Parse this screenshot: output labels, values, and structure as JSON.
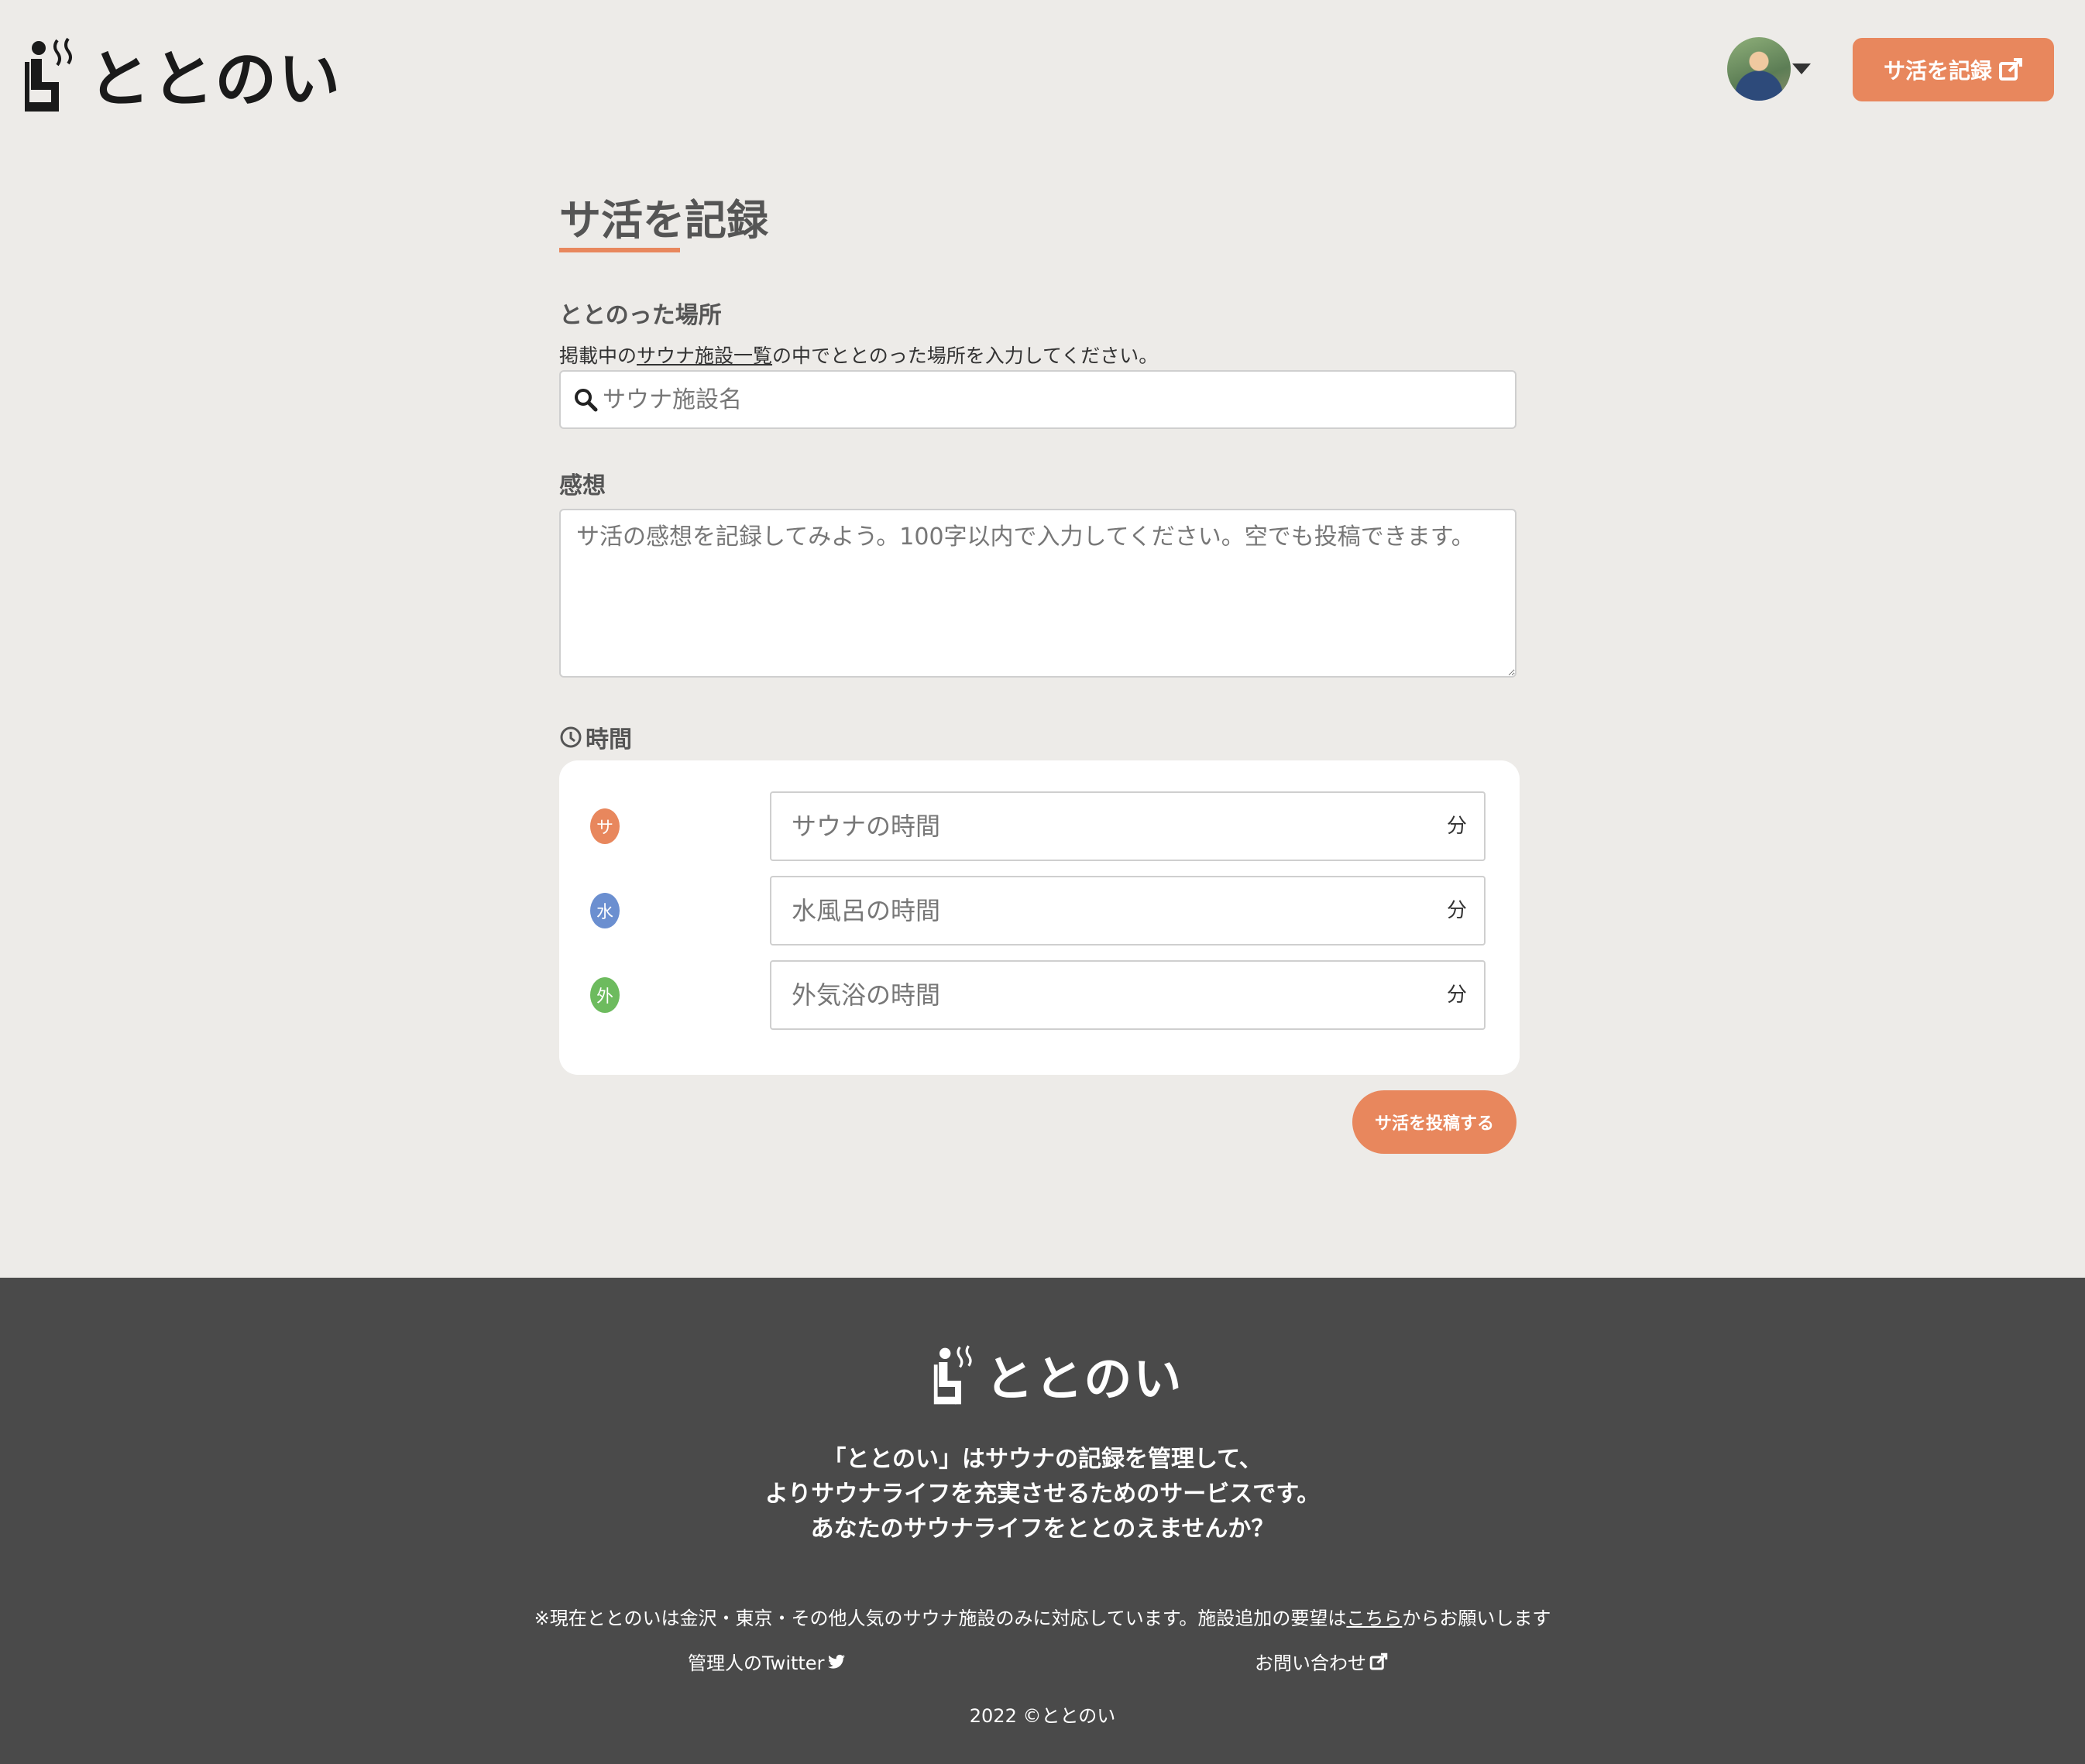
{
  "header": {
    "logo_text": "ととのい",
    "record_button_label": "サ活を記録"
  },
  "form": {
    "title": "サ活を記録",
    "place_label": "ととのった場所",
    "place_help_prefix": "掲載中の",
    "place_help_link": "サウナ施設一覧",
    "place_help_suffix": "の中でととのった場所を入力してください。",
    "place_placeholder": "サウナ施設名",
    "impression_label": "感想",
    "impression_placeholder": "サ活の感想を記録してみよう。100字以内で入力してください。空でも投稿できます。",
    "time_label": "時間",
    "times": [
      {
        "badge": "サ",
        "placeholder": "サウナの時間",
        "unit": "分",
        "color": "#e8875d"
      },
      {
        "badge": "水",
        "placeholder": "水風呂の時間",
        "unit": "分",
        "color": "#6b8fd0"
      },
      {
        "badge": "外",
        "placeholder": "外気浴の時間",
        "unit": "分",
        "color": "#6dbb5e"
      }
    ],
    "submit_label": "サ活を投稿する"
  },
  "footer": {
    "logo_text": "ととのい",
    "desc_line1": "「ととのい」はサウナの記録を管理して、",
    "desc_line2": "よりサウナライフを充実させるためのサービスです。",
    "desc_line3": "あなたのサウナライフをととのえませんか？",
    "note_prefix": "※現在ととのいは金沢・東京・その他人気のサウナ施設のみに対応しています。施設追加の要望は",
    "note_link": "こちら",
    "note_suffix": "からお願いします",
    "twitter_label": "管理人のTwitter",
    "contact_label": "お問い合わせ",
    "copyright": "2022 ©ととのい"
  },
  "colors": {
    "accent": "#e8875d",
    "background": "#edebe8",
    "footer": "#4a4a4a"
  },
  "icons": [
    "sauna-logo-icon",
    "external-link-icon",
    "search-icon",
    "clock-icon",
    "twitter-icon",
    "caret-down-icon"
  ]
}
